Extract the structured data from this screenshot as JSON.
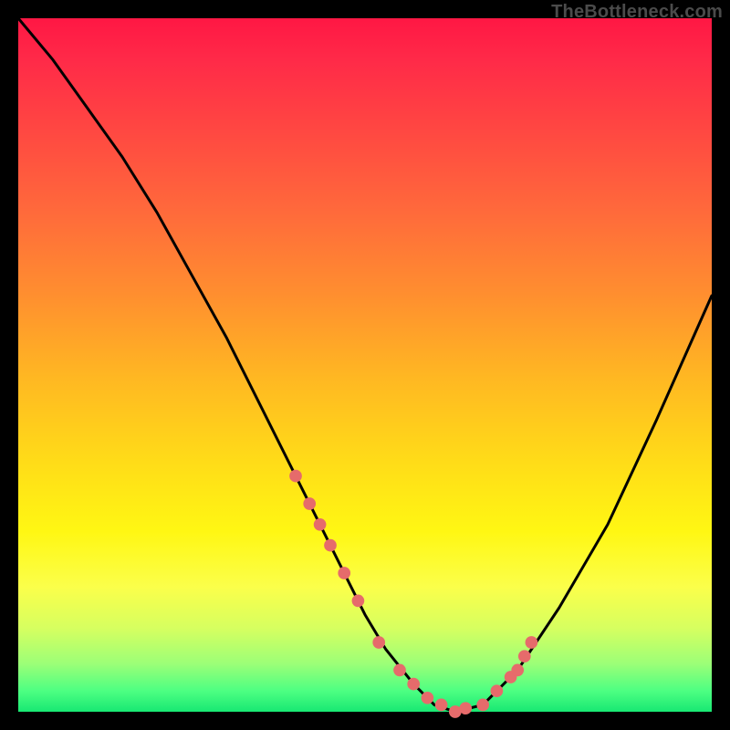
{
  "watermark": "TheBottleneck.com",
  "colors": {
    "background": "#000000",
    "gradient_stops": [
      "#ff1744",
      "#ff6a3b",
      "#ffdc18",
      "#fbff4a",
      "#18e873"
    ],
    "curve_stroke": "#000000",
    "marker_fill": "#e66b6b"
  },
  "chart_data": {
    "type": "line",
    "title": "",
    "xlabel": "",
    "ylabel": "",
    "xlim": [
      0,
      100
    ],
    "ylim": [
      0,
      100
    ],
    "x": [
      0,
      5,
      10,
      15,
      20,
      25,
      30,
      35,
      40,
      45,
      50,
      53,
      57,
      60,
      63,
      67,
      72,
      78,
      85,
      92,
      100
    ],
    "values": [
      100,
      94,
      87,
      80,
      72,
      63,
      54,
      44,
      34,
      24,
      14,
      9,
      4,
      1,
      0,
      1,
      6,
      15,
      27,
      42,
      60
    ],
    "markers_x": [
      40,
      42,
      43.5,
      45,
      47,
      49,
      52,
      55,
      57,
      59,
      61,
      63,
      64.5,
      67,
      69,
      71,
      72,
      73,
      74
    ],
    "markers_y": [
      34,
      30,
      27,
      24,
      20,
      16,
      10,
      6,
      4,
      2,
      1,
      0,
      0.5,
      1,
      3,
      5,
      6,
      8,
      10
    ],
    "annotations": []
  }
}
